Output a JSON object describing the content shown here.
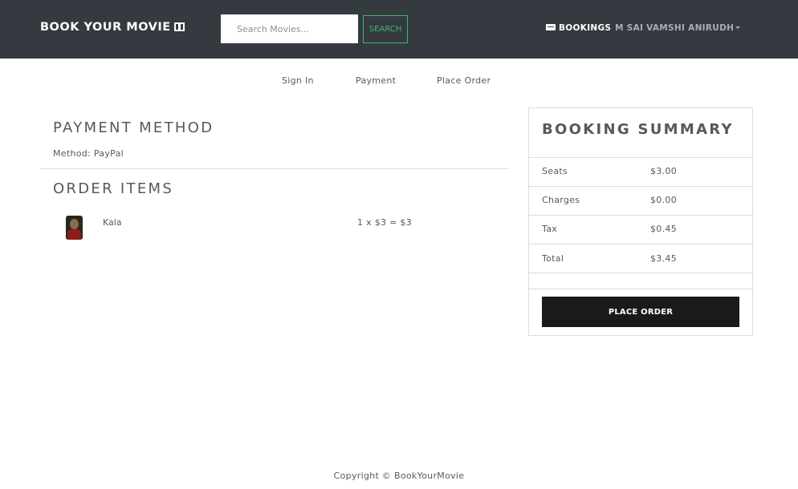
{
  "navbar": {
    "brand": "BOOK YOUR MOVIE",
    "brand_icon": "film-icon",
    "search_placeholder": "Search Movies...",
    "search_button": "SEARCH",
    "bookings_label": "BOOKINGS",
    "bookings_icon": "ticket-icon",
    "user_name": "M SAI VAMSHI ANIRUDH",
    "bg_color": "#343a40",
    "search_accent": "#3fb96b"
  },
  "steps": [
    "Sign In",
    "Payment",
    "Place Order"
  ],
  "payment": {
    "heading": "PAYMENT METHOD",
    "method_text": "Method: PayPal"
  },
  "order": {
    "heading": "ORDER ITEMS",
    "items": [
      {
        "name": "Kala",
        "calc": "1 x $3 = $3"
      }
    ]
  },
  "summary": {
    "heading": "BOOKING SUMMARY",
    "rows": [
      {
        "label": "Seats",
        "value": "$3.00"
      },
      {
        "label": "Charges",
        "value": "$0.00"
      },
      {
        "label": "Tax",
        "value": "$0.45"
      },
      {
        "label": "Total",
        "value": "$3.45"
      }
    ],
    "button": "PLACE ORDER"
  },
  "footer": "Copyright © BookYourMovie"
}
